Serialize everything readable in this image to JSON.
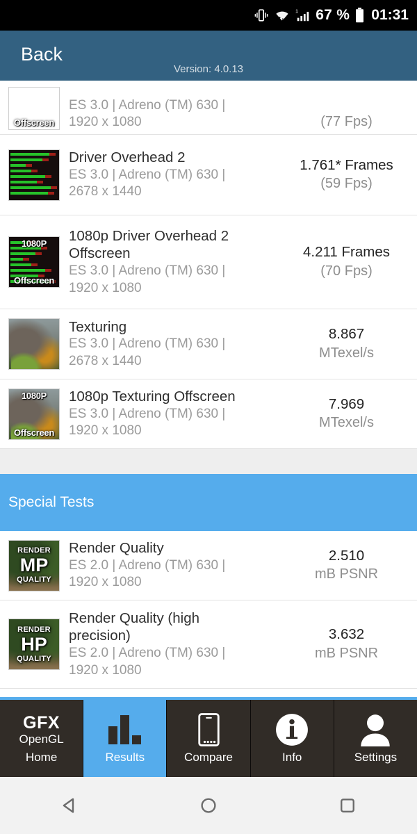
{
  "status_bar": {
    "vibrate_icon": "vibrate-icon",
    "wifi_icon": "wifi-icon",
    "signal_icon": "signal-icon",
    "battery_percent": "67 %",
    "battery_icon": "battery-icon",
    "clock": "01:31"
  },
  "header": {
    "back_label": "Back",
    "version": "Version: 4.0.13",
    "background": "#336181"
  },
  "rows": [
    {
      "title": "",
      "subtitle_line1": "ES 3.0 | Adreno (TM) 630 |",
      "subtitle_line2": "1920 x 1080",
      "value_main": "",
      "value_sub": "(77 Fps)",
      "thumb_top": "",
      "thumb_bottom": "Offscreen",
      "thumb_art": "city"
    },
    {
      "title": "Driver Overhead 2",
      "subtitle_line1": "ES 3.0 | Adreno (TM) 630 |",
      "subtitle_line2": "2678 x 1440",
      "value_main": "1.761* Frames",
      "value_sub": "(59 Fps)",
      "thumb_top": "",
      "thumb_bottom": "",
      "thumb_art": "bars"
    },
    {
      "title": "1080p Driver Overhead 2 Offscreen",
      "subtitle_line1": "ES 3.0 | Adreno (TM) 630 |",
      "subtitle_line2": "1920 x 1080",
      "value_main": "4.211 Frames",
      "value_sub": "(70 Fps)",
      "thumb_top": "1080P",
      "thumb_bottom": "Offscreen",
      "thumb_art": "bars"
    },
    {
      "title": "Texturing",
      "subtitle_line1": "ES 3.0 | Adreno (TM) 630 |",
      "subtitle_line2": "2678 x 1440",
      "value_main": "8.867",
      "value_sub": "MTexel/s",
      "thumb_top": "",
      "thumb_bottom": "",
      "thumb_art": "dino"
    },
    {
      "title": "1080p Texturing Offscreen",
      "subtitle_line1": "ES 3.0 | Adreno (TM) 630 |",
      "subtitle_line2": "1920 x 1080",
      "value_main": "7.969",
      "value_sub": "MTexel/s",
      "thumb_top": "1080P",
      "thumb_bottom": "Offscreen",
      "thumb_art": "dino"
    }
  ],
  "section": {
    "title": "Special Tests",
    "background": "#55acec"
  },
  "special_rows": [
    {
      "title": "Render Quality",
      "subtitle_line1": "ES 2.0 | Adreno (TM) 630 |",
      "subtitle_line2": "1920 x 1080",
      "value_main": "2.510",
      "value_sub": "mB PSNR",
      "label_top": "RENDER",
      "label_big": "MP",
      "label_bottom": "QUALITY"
    },
    {
      "title": "Render Quality (high precision)",
      "subtitle_line1": "ES 2.0 | Adreno (TM) 630 |",
      "subtitle_line2": "1920 x 1080",
      "value_main": "3.632",
      "value_sub": "mB PSNR",
      "label_top": "RENDER",
      "label_big": "HP",
      "label_bottom": "QUALITY"
    }
  ],
  "tabs": [
    {
      "label": "Home",
      "icon": "gfx-opengl-logo-icon",
      "logo_line1": "GFX",
      "logo_line2": "OpenGL",
      "active": false
    },
    {
      "label": "Results",
      "icon": "bar-chart-icon",
      "active": true
    },
    {
      "label": "Compare",
      "icon": "smartphone-icon",
      "active": false
    },
    {
      "label": "Info",
      "icon": "info-circle-icon",
      "active": false
    },
    {
      "label": "Settings",
      "icon": "person-icon",
      "active": false
    }
  ],
  "android_nav": {
    "back_icon": "triangle-back-icon",
    "home_icon": "circle-home-icon",
    "recents_icon": "square-recents-icon"
  }
}
